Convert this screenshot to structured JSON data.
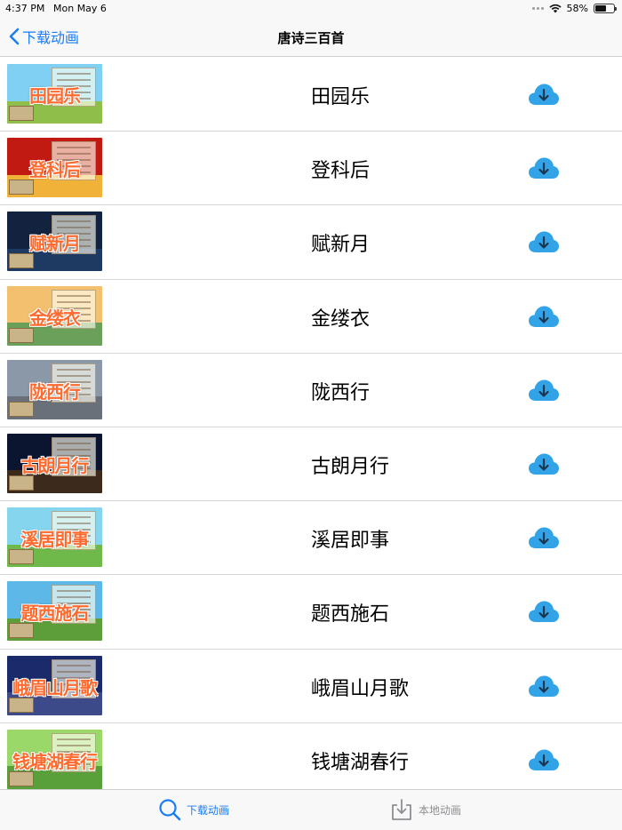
{
  "status_bar": {
    "time": "4:37 PM",
    "date": "Mon May 6",
    "battery": "58%",
    "battery_level": 0.58
  },
  "nav": {
    "back_label": "下载动画",
    "title": "唐诗三百首"
  },
  "colors": {
    "accent": "#1a7cf5",
    "cloud": "#33a3e8",
    "inactive": "#8e8e93",
    "thumb_title": "#ff6a2e"
  },
  "list": {
    "items": [
      {
        "title": "田园乐",
        "thumb_title": "田园乐",
        "thumb_sky": "#7fd0f2",
        "thumb_ground": "#8fbf4a",
        "action_icon": "cloud-download-icon"
      },
      {
        "title": "登科后",
        "thumb_title": "登科后",
        "thumb_sky": "#c01a12",
        "thumb_ground": "#f1b23a",
        "action_icon": "cloud-download-icon"
      },
      {
        "title": "赋新月",
        "thumb_title": "赋新月",
        "thumb_sky": "#13233f",
        "thumb_ground": "#1f3a62",
        "action_icon": "cloud-download-icon"
      },
      {
        "title": "金缕衣",
        "thumb_title": "金缕衣",
        "thumb_sky": "#f3c070",
        "thumb_ground": "#6aa05a",
        "action_icon": "cloud-download-icon"
      },
      {
        "title": "陇西行",
        "thumb_title": "陇西行",
        "thumb_sky": "#8a98a8",
        "thumb_ground": "#6a707a",
        "action_icon": "cloud-download-icon"
      },
      {
        "title": "古朗月行",
        "thumb_title": "古朗月行",
        "thumb_sky": "#0c1530",
        "thumb_ground": "#3c2a1c",
        "action_icon": "cloud-download-icon"
      },
      {
        "title": "溪居即事",
        "thumb_title": "溪居即事",
        "thumb_sky": "#86d5ee",
        "thumb_ground": "#6fb84a",
        "action_icon": "cloud-download-icon"
      },
      {
        "title": "题西施石",
        "thumb_title": "题西施石",
        "thumb_sky": "#5db8e8",
        "thumb_ground": "#5d9e3a",
        "action_icon": "cloud-download-icon"
      },
      {
        "title": "峨眉山月歌",
        "thumb_title": "峨眉山月歌",
        "thumb_sky": "#1a2a6a",
        "thumb_ground": "#3c4a8a",
        "action_icon": "cloud-download-icon"
      },
      {
        "title": "钱塘湖春行",
        "thumb_title": "钱塘湖春行",
        "thumb_sky": "#9bd86a",
        "thumb_ground": "#5aa03a",
        "action_icon": "cloud-download-icon"
      }
    ]
  },
  "tab_bar": {
    "tabs": [
      {
        "label": "下载动画",
        "icon": "search-icon",
        "active": true
      },
      {
        "label": "本地动画",
        "icon": "download-tray-icon",
        "active": false
      }
    ]
  }
}
